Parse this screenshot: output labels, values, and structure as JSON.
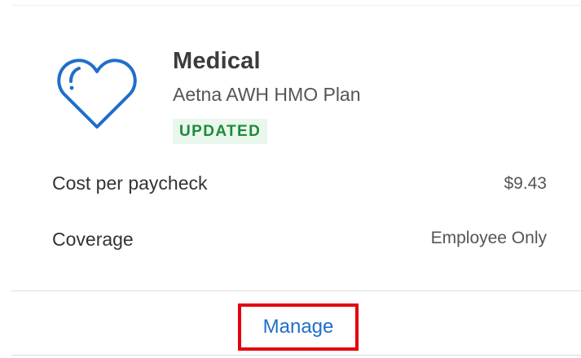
{
  "card": {
    "title": "Medical",
    "plan_name": "Aetna AWH HMO Plan",
    "status": "UPDATED",
    "icon": "heart-icon",
    "rows": [
      {
        "label": "Cost per paycheck",
        "value": "$9.43"
      },
      {
        "label": "Coverage",
        "value": "Employee Only"
      }
    ],
    "action_label": "Manage"
  },
  "colors": {
    "accent": "#1f6fc8",
    "status_bg": "#e9f7ec",
    "status_text": "#1e8a3a",
    "highlight": "#e4000f"
  }
}
